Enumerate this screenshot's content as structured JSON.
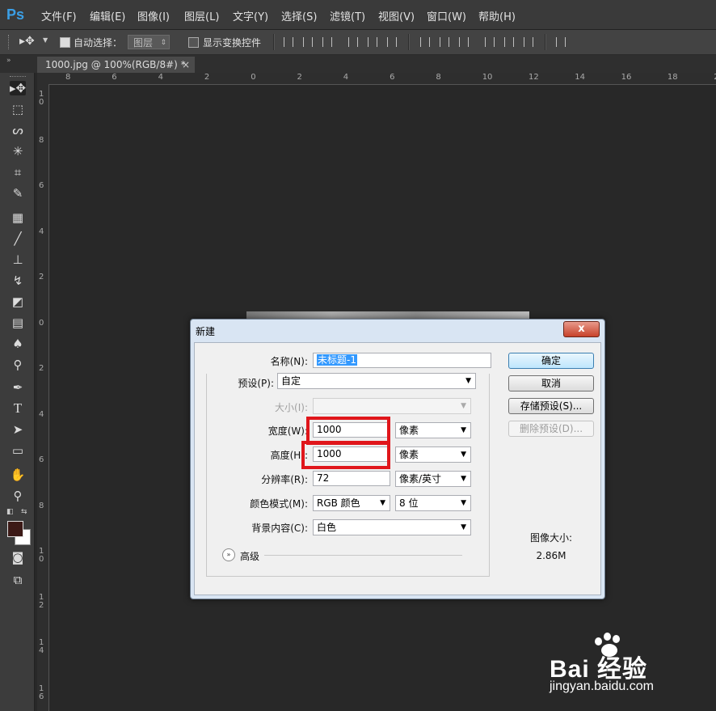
{
  "app": {
    "logo": "Ps"
  },
  "menu": [
    "文件(F)",
    "编辑(E)",
    "图像(I)",
    "图层(L)",
    "文字(Y)",
    "选择(S)",
    "滤镜(T)",
    "视图(V)",
    "窗口(W)",
    "帮助(H)"
  ],
  "options": {
    "auto_select_label": "自动选择：",
    "layer_value": "图层",
    "show_transform_label": "显示变换控件"
  },
  "document_tab": {
    "title": "1000.jpg @ 100%(RGB/8#) *",
    "close": "×"
  },
  "ruler_top": [
    "8",
    "6",
    "4",
    "2",
    "0",
    "2",
    "4",
    "6",
    "8",
    "10",
    "12",
    "14",
    "16",
    "18",
    "20"
  ],
  "ruler_left": [
    "1\n0",
    "8",
    "6",
    "4",
    "2",
    "0",
    "2",
    "4",
    "6",
    "8",
    "1\n0",
    "1\n2",
    "1\n4",
    "1\n6"
  ],
  "dialog": {
    "title": "新建",
    "close": "x",
    "name_label": "名称(N):",
    "name_value": "未标题-1",
    "preset_label": "预设(P):",
    "preset_value": "自定",
    "size_label": "大小(I):",
    "size_value": "",
    "width_label": "宽度(W):",
    "width_value": "1000",
    "width_unit": "像素",
    "height_label": "高度(H):",
    "height_value": "1000",
    "height_unit": "像素",
    "resolution_label": "分辨率(R):",
    "resolution_value": "72",
    "resolution_unit": "像素/英寸",
    "color_mode_label": "颜色模式(M):",
    "color_mode_value": "RGB 颜色",
    "bit_depth_value": "8 位",
    "background_label": "背景内容(C):",
    "background_value": "白色",
    "advanced_label": "高级",
    "ok_button": "确定",
    "cancel_button": "取消",
    "save_preset_button": "存储预设(S)...",
    "delete_preset_button": "删除预设(D)...",
    "image_size_label": "图像大小:",
    "image_size_value": "2.86M"
  },
  "watermark": {
    "brand": "Bai 经验",
    "url": "jingyan.baidu.com"
  },
  "colors": {
    "highlight": "#e0161b",
    "accent": "#3399ff"
  }
}
